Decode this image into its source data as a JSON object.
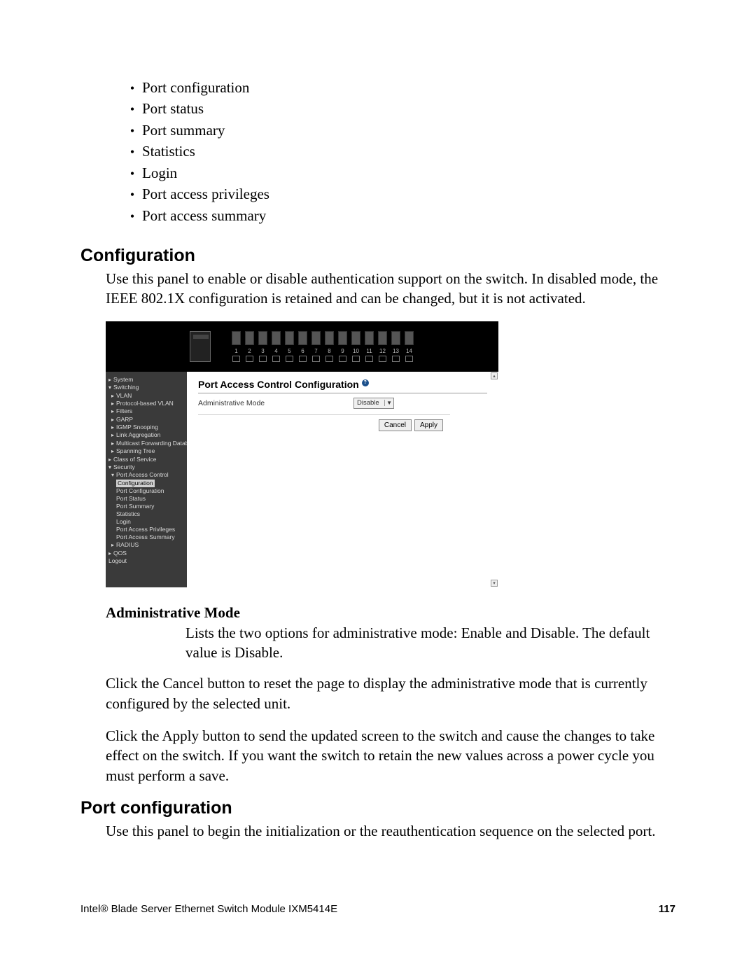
{
  "bullets": [
    "Port configuration",
    "Port status",
    "Port summary",
    "Statistics",
    "Login",
    "Port access privileges",
    "Port access summary"
  ],
  "section1": {
    "heading": "Configuration",
    "para": "Use this panel to enable or disable authentication support on the switch. In disabled mode, the IEEE 802.1X configuration is retained and can be changed, but it is not activated."
  },
  "screenshot": {
    "ports": [
      "1",
      "2",
      "3",
      "4",
      "5",
      "6",
      "7",
      "8",
      "9",
      "10",
      "11",
      "12",
      "13",
      "14"
    ],
    "nav": {
      "i0": {
        "text": "System",
        "kind": "bul"
      },
      "i1": {
        "text": "Switching",
        "kind": "car"
      },
      "i2": {
        "text": "VLAN",
        "kind": "bul"
      },
      "i3": {
        "text": "Protocol-based VLAN",
        "kind": "bul"
      },
      "i4": {
        "text": "Filters",
        "kind": "bul"
      },
      "i5": {
        "text": "GARP",
        "kind": "bul"
      },
      "i6": {
        "text": "IGMP Snooping",
        "kind": "bul"
      },
      "i7": {
        "text": "Link Aggregation",
        "kind": "bul"
      },
      "i8": {
        "text": "Multicast Forwarding Database",
        "kind": "bul"
      },
      "i9": {
        "text": "Spanning Tree",
        "kind": "bul"
      },
      "i10": {
        "text": "Class of Service",
        "kind": "bul"
      },
      "i11": {
        "text": "Security",
        "kind": "car"
      },
      "i12": {
        "text": "Port Access Control",
        "kind": "car"
      },
      "i13": {
        "text": "Configuration",
        "kind": "sel"
      },
      "i14": {
        "text": "Port Configuration",
        "kind": "none"
      },
      "i15": {
        "text": "Port Status",
        "kind": "none"
      },
      "i16": {
        "text": "Port Summary",
        "kind": "none"
      },
      "i17": {
        "text": "Statistics",
        "kind": "none"
      },
      "i18": {
        "text": "Login",
        "kind": "none"
      },
      "i19": {
        "text": "Port Access Privileges",
        "kind": "none"
      },
      "i20": {
        "text": "Port Access Summary",
        "kind": "none"
      },
      "i21": {
        "text": "RADIUS",
        "kind": "bul"
      },
      "i22": {
        "text": "QOS",
        "kind": "bul"
      },
      "i23": {
        "text": "Logout",
        "kind": "none"
      }
    },
    "panel": {
      "title": "Port Access Control Configuration",
      "help": "?",
      "field_label": "Administrative Mode",
      "select_value": "Disable",
      "cancel": "Cancel",
      "apply": "Apply"
    }
  },
  "adminmode": {
    "heading": "Administrative Mode",
    "desc": "Lists the two options for administrative mode: Enable and Disable. The default value is Disable."
  },
  "para_cancel": "Click the Cancel button to reset the page to display the administrative mode that is currently configured by the selected unit.",
  "para_apply": "Click the Apply button to send the updated screen to the switch and cause the changes to take effect on the switch. If you want the switch to retain the new values across a power cycle you must perform a save.",
  "section2": {
    "heading": "Port configuration",
    "para": "Use this panel to begin the initialization or the reauthentication sequence on the selected port."
  },
  "footer": {
    "left": "Intel® Blade Server Ethernet Switch Module IXM5414E",
    "page": "117"
  }
}
